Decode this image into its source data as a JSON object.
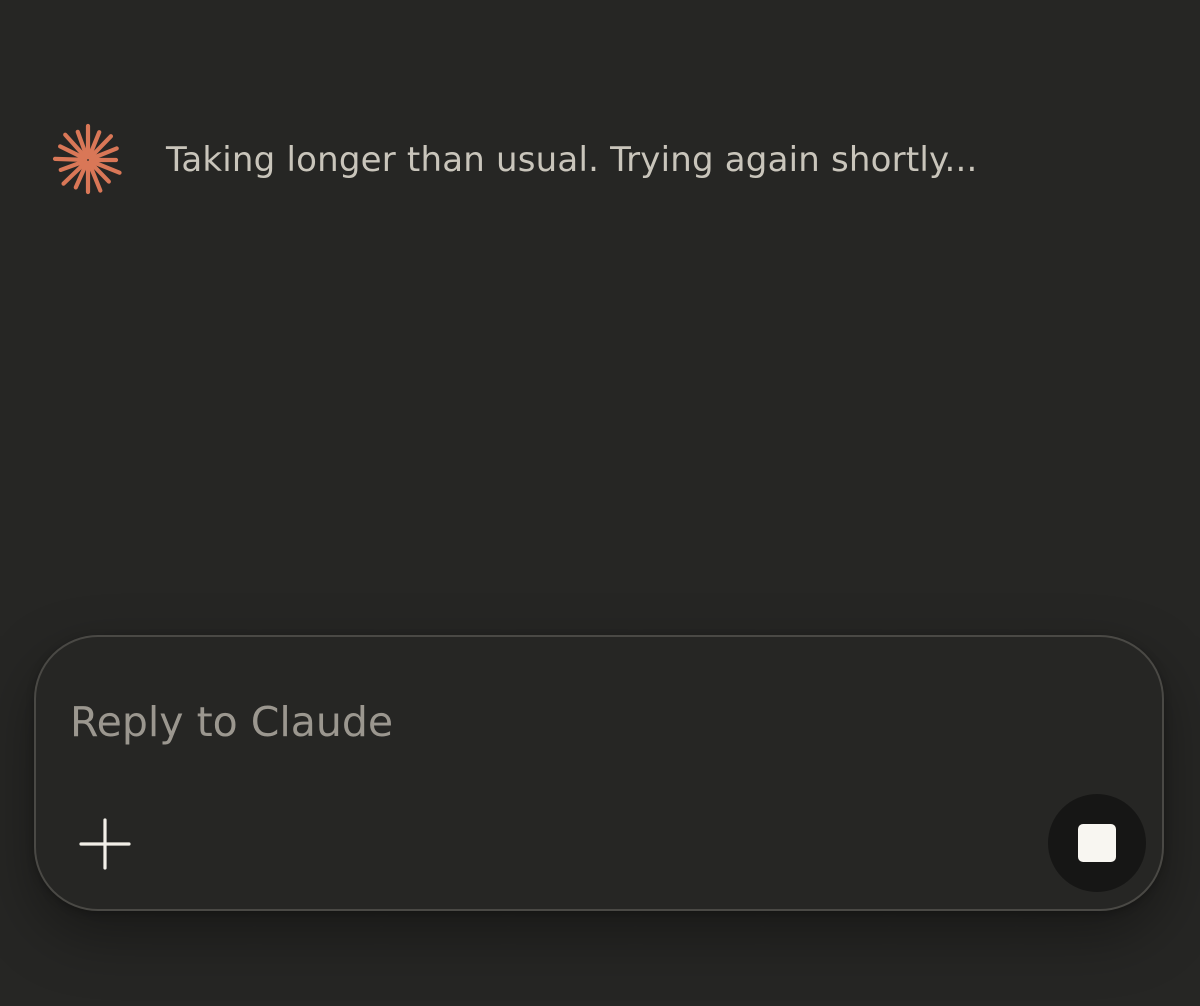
{
  "status": {
    "icon": "claude-spark-icon",
    "icon_color": "#d97757",
    "message": "Taking longer than usual. Trying again shortly..."
  },
  "composer": {
    "placeholder": "Reply to Claude",
    "value": "",
    "add_button_icon": "plus-icon",
    "stop_button_icon": "stop-square-icon"
  },
  "colors": {
    "background": "#262624",
    "text": "#c9c5bb",
    "placeholder": "#9b978f",
    "stop_button_bg": "#161615"
  }
}
